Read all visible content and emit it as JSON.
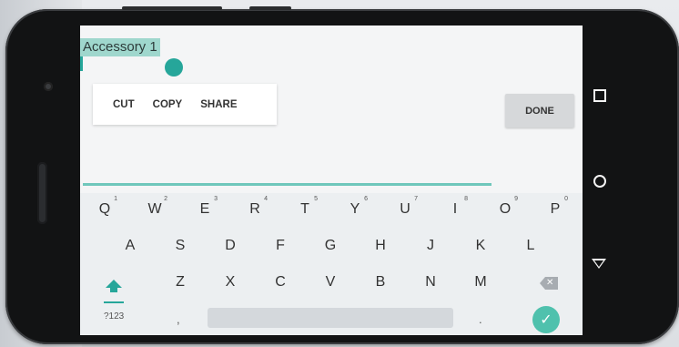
{
  "editor": {
    "selected_text": "Accessory 1",
    "done_label": "DONE"
  },
  "context_menu": {
    "items": [
      "CUT",
      "COPY",
      "SHARE"
    ]
  },
  "keyboard": {
    "row1": [
      {
        "key": "Q",
        "hint": "1"
      },
      {
        "key": "W",
        "hint": "2"
      },
      {
        "key": "E",
        "hint": "3"
      },
      {
        "key": "R",
        "hint": "4"
      },
      {
        "key": "T",
        "hint": "5"
      },
      {
        "key": "Y",
        "hint": "6"
      },
      {
        "key": "U",
        "hint": "7"
      },
      {
        "key": "I",
        "hint": "8"
      },
      {
        "key": "O",
        "hint": "9"
      },
      {
        "key": "P",
        "hint": "0"
      }
    ],
    "row2": [
      "A",
      "S",
      "D",
      "F",
      "G",
      "H",
      "J",
      "K",
      "L"
    ],
    "row3": [
      "Z",
      "X",
      "C",
      "V",
      "B",
      "N",
      "M"
    ],
    "symbols_label": "?123",
    "comma": ",",
    "period": ".",
    "enter_symbol": "✓",
    "backspace_symbol": "✕"
  },
  "icons": {
    "shift": "shift-arrow-icon",
    "backspace": "backspace-icon",
    "enter": "check-circle-icon",
    "nav": [
      "square-recents-icon",
      "circle-home-icon",
      "triangle-back-icon"
    ]
  },
  "colors": {
    "accent": "#26a69a",
    "selection": "#9fd7cd",
    "field_underline": "#6fc7bb",
    "enter_key": "#4fc1ad"
  }
}
